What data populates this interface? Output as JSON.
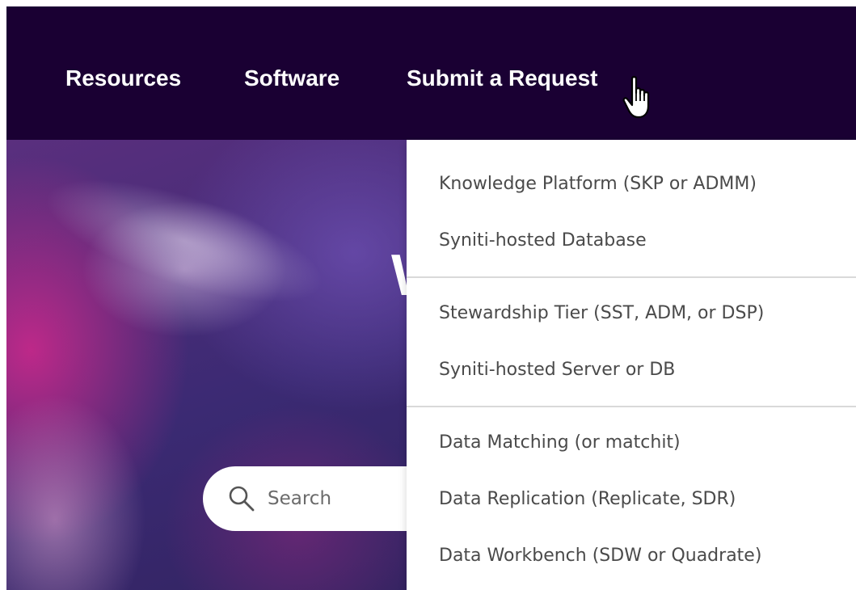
{
  "nav": {
    "items": [
      {
        "label": "Resources"
      },
      {
        "label": "Software"
      },
      {
        "label": "Submit a Request"
      }
    ]
  },
  "hero": {
    "title_partial": "W"
  },
  "search": {
    "placeholder": "Search",
    "value": ""
  },
  "dropdown": {
    "groups": [
      {
        "items": [
          {
            "label": "Knowledge Platform (SKP or ADMM)"
          },
          {
            "label": "Syniti-hosted Database"
          }
        ]
      },
      {
        "items": [
          {
            "label": "Stewardship Tier (SST, ADM, or DSP)"
          },
          {
            "label": "Syniti-hosted Server or DB"
          }
        ]
      },
      {
        "items": [
          {
            "label": "Data Matching (or matchit)"
          },
          {
            "label": "Data Replication (Replicate, SDR)"
          },
          {
            "label": "Data Workbench (SDW or Quadrate)"
          }
        ]
      }
    ]
  },
  "icons": {
    "cursor": "hand-pointer-icon",
    "search": "search-icon"
  },
  "colors": {
    "nav_bg": "#1a0033",
    "menu_text": "#4a4a4a",
    "divider": "#d9d9d9"
  }
}
